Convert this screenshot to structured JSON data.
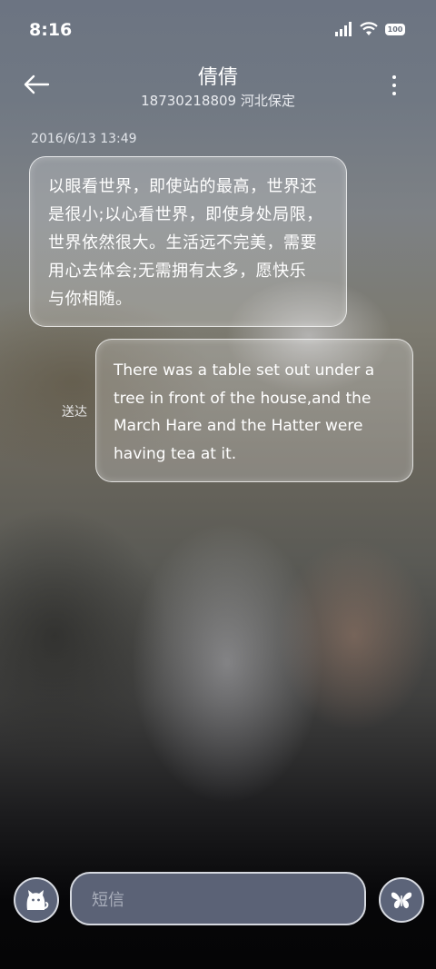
{
  "status_bar": {
    "time": "8:16",
    "battery": "100",
    "icons": [
      "signal-icon",
      "wifi-icon",
      "battery-icon"
    ]
  },
  "header": {
    "title": "倩倩",
    "subtitle": "18730218809 河北保定",
    "icons": [
      "back-arrow-icon",
      "more-vertical-icon"
    ]
  },
  "conversation": {
    "timestamp": "2016/6/13 13:49",
    "messages": [
      {
        "direction": "incoming",
        "lines": [
          "以眼看世界，即使站的最高，世界还",
          "是很小;以心看世界，即使身处局限，",
          "世界依然很大。生活远不完美，需要",
          "用心去体会;无需拥有太多，愿快乐",
          "与你相随。"
        ]
      },
      {
        "direction": "outgoing",
        "status": "送达",
        "lines": [
          "There was a table set out under a",
          "tree in front of the house,and the",
          "March Hare and the Hatter were",
          "having tea at it."
        ]
      }
    ]
  },
  "composer": {
    "placeholder": "短信",
    "left_icon": "cat-icon",
    "right_icon": "butterfly-icon"
  },
  "colors": {
    "button_fill": "#5c6479",
    "button_border": "#d8dbe2",
    "bubble_border": "#ffffff"
  }
}
